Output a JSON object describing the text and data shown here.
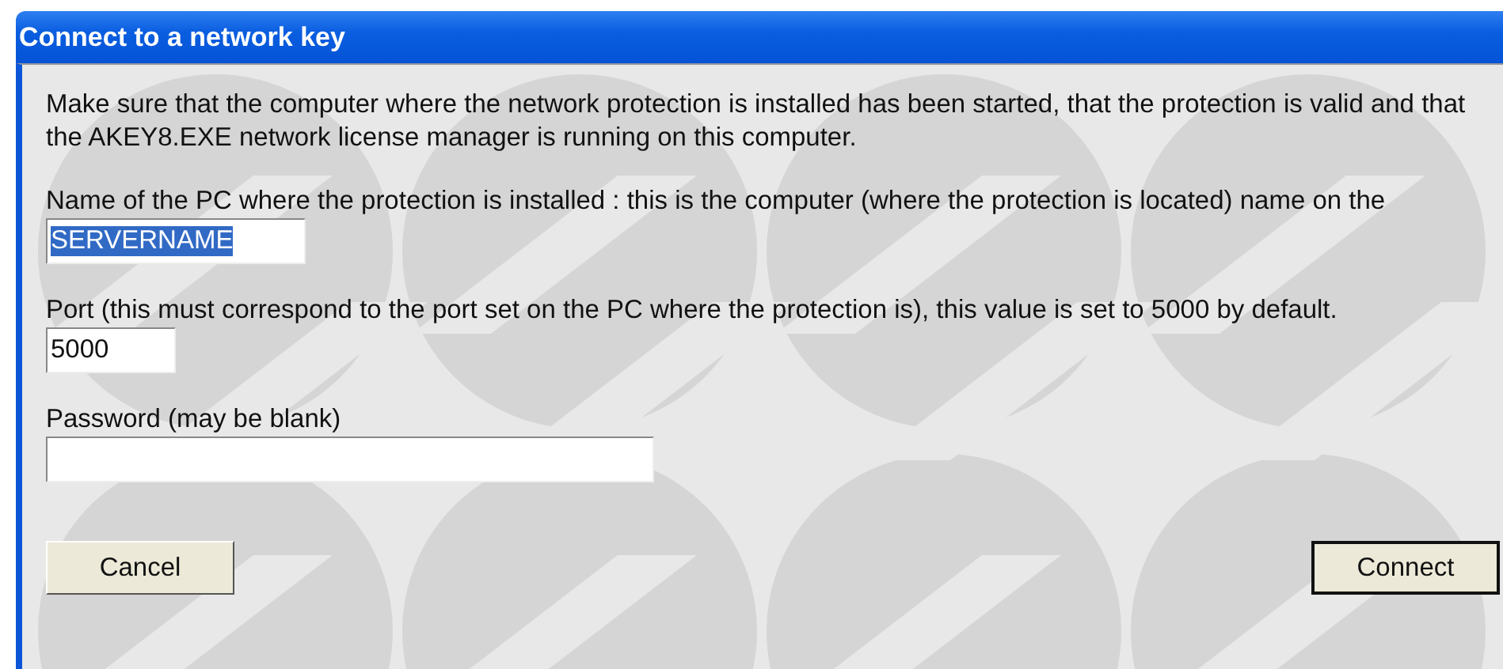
{
  "window": {
    "title": "Connect to a network key"
  },
  "intro": "Make sure that the computer where the network protection is installed has been started, that the protection is valid and that the AKEY8.EXE network license manager is running on this computer.",
  "fields": [
    {
      "label": "Name of the PC where the protection is installed : this is the computer (where the protection is located) name on the",
      "value": "SERVERNAME",
      "highlighted": true
    },
    {
      "label": "Port (this must correspond to the port set on the PC where the protection is), this value is set to 5000 by default.",
      "value": "5000",
      "highlighted": false
    },
    {
      "label": "Password (may be blank)"
    }
  ],
  "buttons": [
    {
      "label": "Cancel",
      "default": false
    },
    {
      "label": "Connect",
      "default": true
    }
  ]
}
